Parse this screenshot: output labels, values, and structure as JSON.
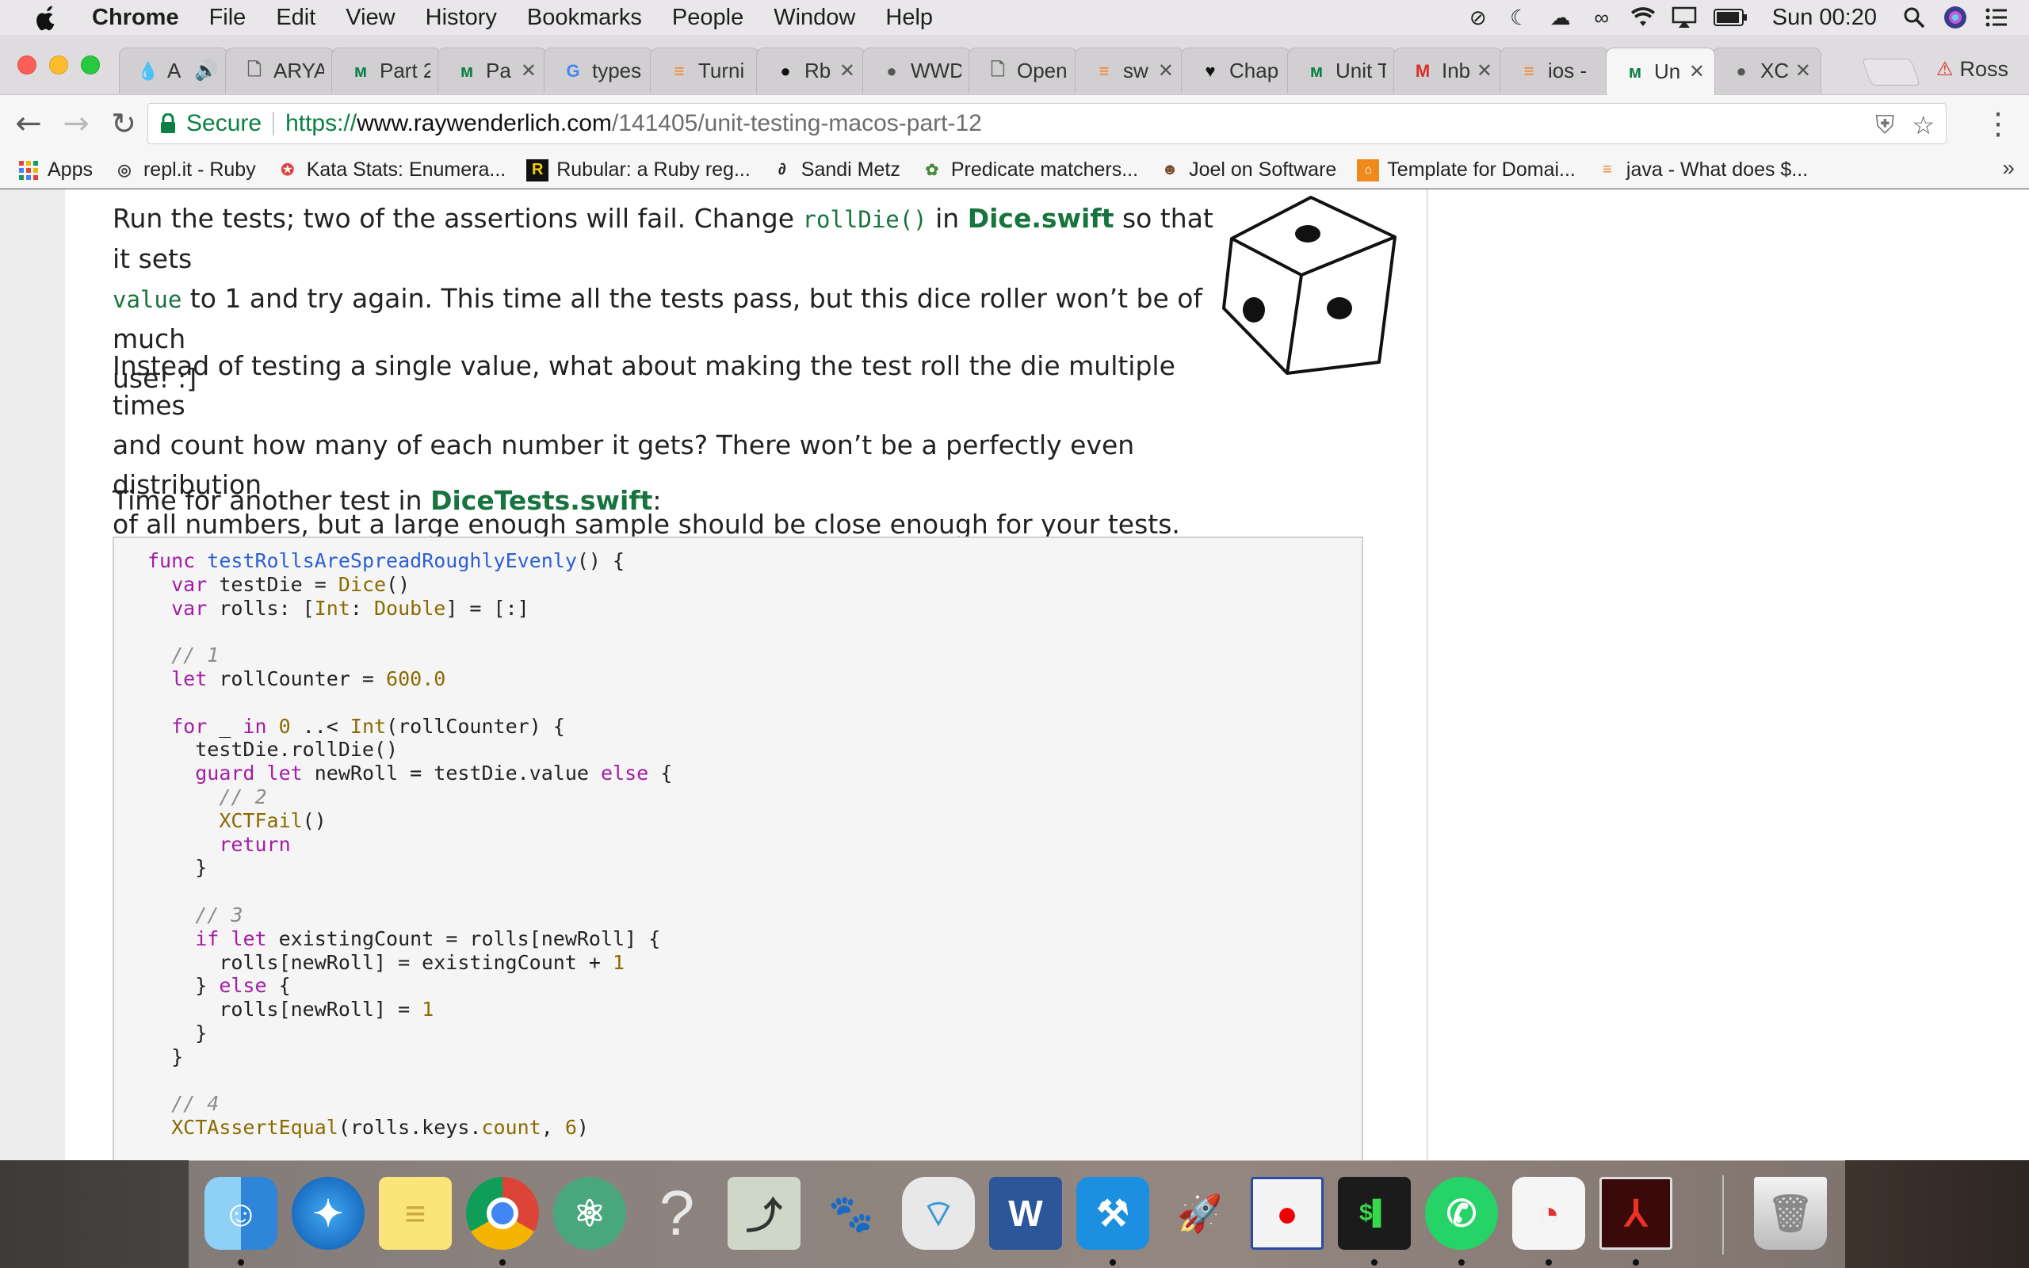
{
  "menubar": {
    "app": "Chrome",
    "items": [
      "File",
      "Edit",
      "View",
      "History",
      "Bookmarks",
      "People",
      "Window",
      "Help"
    ],
    "clock": "Sun 00:20"
  },
  "tabs": [
    {
      "label": "A",
      "icon": "drop-icon"
    },
    {
      "label": "ARYA",
      "icon": "page-icon"
    },
    {
      "label": "Part 2",
      "icon": "rw-icon"
    },
    {
      "label": "Pa",
      "icon": "rw-icon"
    },
    {
      "label": "types",
      "icon": "google-icon"
    },
    {
      "label": "Turni",
      "icon": "stackoverflow-icon"
    },
    {
      "label": "Rb",
      "icon": "github-icon"
    },
    {
      "label": "WWD",
      "icon": "apple-icon"
    },
    {
      "label": "Open",
      "icon": "page-icon"
    },
    {
      "label": "sw",
      "icon": "stackoverflow-icon"
    },
    {
      "label": "Chap",
      "icon": "heart-icon"
    },
    {
      "label": "Unit T",
      "icon": "rw-icon"
    },
    {
      "label": "Inb",
      "icon": "gmail-icon"
    },
    {
      "label": "ios -",
      "icon": "stackoverflow-icon"
    },
    {
      "label": "Un",
      "icon": "rw-icon",
      "active": true
    },
    {
      "label": "XC",
      "icon": "apple-icon"
    }
  ],
  "profile_name": "Ross",
  "toolbar": {
    "secure_label": "Secure",
    "url_scheme": "https://",
    "url_host": "www.raywenderlich.com",
    "url_path": "/141405/unit-testing-macos-part-12"
  },
  "bookmarks": [
    {
      "label": "Apps",
      "icon": "apps-grid-icon"
    },
    {
      "label": "repl.it - Ruby",
      "icon": "replit-icon"
    },
    {
      "label": "Kata Stats: Enumera...",
      "icon": "codewars-icon"
    },
    {
      "label": "Rubular: a Ruby reg...",
      "icon": "rubular-icon"
    },
    {
      "label": "Sandi Metz",
      "icon": "sandi-icon"
    },
    {
      "label": "Predicate matchers...",
      "icon": "rspec-icon"
    },
    {
      "label": "Joel on Software",
      "icon": "joel-icon"
    },
    {
      "label": "Template for Domai...",
      "icon": "template-icon"
    },
    {
      "label": "java - What does $...",
      "icon": "stackoverflow-icon"
    }
  ],
  "article": {
    "p1_a": "Run the tests; two of the assertions will fail. Change ",
    "p1_code1": "rollDie()",
    "p1_b": " in ",
    "p1_file": "Dice.swift",
    "p1_c": " so that it sets",
    "p1_code2": "value",
    "p1_d": " to 1 and try again. This time all the tests pass, but this dice roller won’t be of much",
    "p1_e": "use! :]",
    "p2_l1": "Instead of testing a single value, what about making the test roll the die multiple times",
    "p2_l2": "and count how many of each number it gets? There won’t be a perfectly even distribution",
    "p2_l3": "of all numbers, but a large enough sample should be close enough for your tests.",
    "p3_a": "Time for another test in ",
    "p3_file": "DiceTests.swift",
    "p3_b": ":"
  },
  "code": {
    "func_kw": "func",
    "func_name": "testRollsAreSpreadRoughlyEvenly",
    "func_tail": "() {",
    "l2_kw": "var",
    "l2_a": " testDie = ",
    "l2_type": "Dice",
    "l2_b": "()",
    "l3_kw": "var",
    "l3_a": " rolls: [",
    "l3_t1": "Int",
    "l3_b": ": ",
    "l3_t2": "Double",
    "l3_c": "] = [:]",
    "c1": "// 1",
    "l6_kw": "let",
    "l6_a": " rollCounter = ",
    "l6_num": "600.0",
    "l8_kw1": "for",
    "l8_a": " _ ",
    "l8_kw2": "in",
    "l8_b": " ",
    "l8_num": "0",
    "l8_c": " ..< ",
    "l8_type": "Int",
    "l8_d": "(rollCounter) {",
    "l9": "testDie.rollDie()",
    "l10_kw1": "guard",
    "l10_kw2": "let",
    "l10_a": " newRoll = testDie.value ",
    "l10_kw3": "else",
    "l10_b": " {",
    "c2": "// 2",
    "l12": "XCTFail",
    "l12_b": "()",
    "l13": "return",
    "brace": "}",
    "c3": "// 3",
    "l17_kw1": "if",
    "l17_kw2": "let",
    "l17_a": " existingCount = rolls[newRoll] {",
    "l18_a": "rolls[newRoll] = existingCount + ",
    "l18_num": "1",
    "l19_a": "} ",
    "l19_kw": "else",
    "l19_b": " {",
    "l20_a": "rolls[newRoll] = ",
    "l20_num": "1",
    "c4": "// 4",
    "l25_fn": "XCTAssertEqual",
    "l25_a": "(rolls.keys.",
    "l25_prop": "count",
    "l25_b": ", ",
    "l25_num": "6",
    "l25_c": ")"
  },
  "dock": [
    "Finder",
    "Safari",
    "Notes",
    "Chrome",
    "Atom",
    "Help",
    "Preview",
    "GIMP",
    "AirPort Utility",
    "Word",
    "Xcode",
    "Launchpad",
    "Screen Recorder",
    "Terminal",
    "WhatsApp",
    "Instruments",
    "Acrobat",
    "Trash"
  ],
  "colors": {
    "green_link": "#17743f",
    "keyword": "#a31da5",
    "function": "#2d5fd1"
  }
}
